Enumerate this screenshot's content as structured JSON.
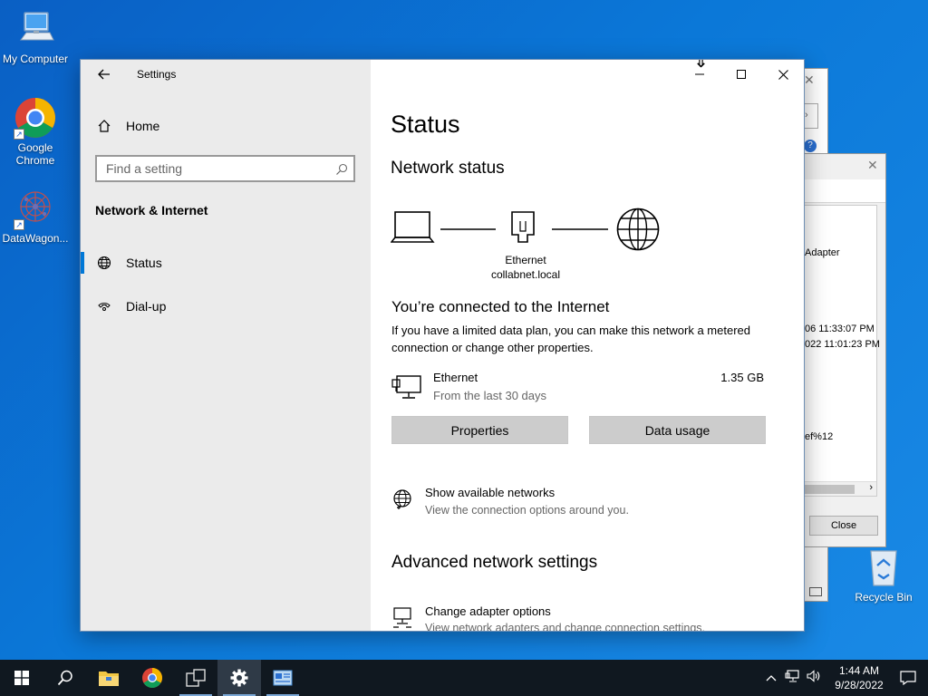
{
  "desktop": {
    "icons": [
      {
        "label": "My Computer",
        "icon": "computer-icon"
      },
      {
        "label": "Google Chrome",
        "icon": "chrome-icon"
      },
      {
        "label": "DataWagon...",
        "icon": "datawagon-icon"
      },
      {
        "label": "Recycle Bin",
        "icon": "recycle-bin-icon"
      }
    ]
  },
  "background_dialog": {
    "texts": [
      "Adapter",
      "06 11:33:07 PM",
      "022 11:01:23 PM",
      "ef%12"
    ],
    "close_button": "Close"
  },
  "settings": {
    "title": "Settings",
    "home_label": "Home",
    "search_placeholder": "Find a setting",
    "section_title": "Network & Internet",
    "nav": [
      {
        "label": "Status",
        "icon": "globe-icon",
        "selected": true
      },
      {
        "label": "Dial-up",
        "icon": "dialup-icon",
        "selected": false
      }
    ],
    "page_title": "Status",
    "network_status_heading": "Network status",
    "diagram": {
      "adapter_name": "Ethernet",
      "domain": "collabnet.local"
    },
    "connected_heading": "You’re connected to the Internet",
    "connected_description": "If you have a limited data plan, you can make this network a metered connection or change other properties.",
    "connection": {
      "name": "Ethernet",
      "subtitle": "From the last 30 days",
      "usage": "1.35 GB"
    },
    "properties_button": "Properties",
    "data_usage_button": "Data usage",
    "show_networks": {
      "title": "Show available networks",
      "subtitle": "View the connection options around you."
    },
    "advanced_heading": "Advanced network settings",
    "change_adapter": {
      "title": "Change adapter options",
      "subtitle": "View network adapters and change connection settings."
    }
  },
  "taskbar": {
    "time": "1:44 AM",
    "date": "9/28/2022"
  },
  "colors": {
    "accent": "#0078d7",
    "sidebar_bg": "#ebebeb",
    "taskbar_bg": "#101820"
  }
}
